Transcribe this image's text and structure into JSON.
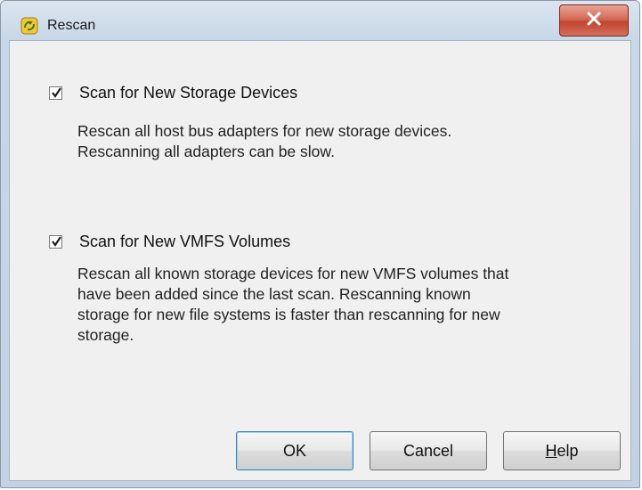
{
  "window": {
    "title": "Rescan",
    "close_glyph": "X"
  },
  "options": [
    {
      "label": "Scan for New Storage Devices",
      "checked": true,
      "description_lines": [
        "Rescan all host bus adapters for new storage devices.",
        "Rescanning all adapters can be slow."
      ]
    },
    {
      "label": "Scan for New VMFS Volumes",
      "checked": true,
      "description_lines": [
        "Rescan all known storage devices for new VMFS volumes that",
        "have been added since the last scan. Rescanning known",
        "storage for new file systems is faster than rescanning for new",
        "storage."
      ]
    }
  ],
  "buttons": {
    "ok": "OK",
    "cancel": "Cancel",
    "help_mnemonic": "H",
    "help_rest": "elp"
  },
  "colors": {
    "close_button": "#c24530",
    "dialog_frame": "#c2d1e3",
    "client_area": "#f0f0f0",
    "default_button_border": "#3c7fb1"
  }
}
